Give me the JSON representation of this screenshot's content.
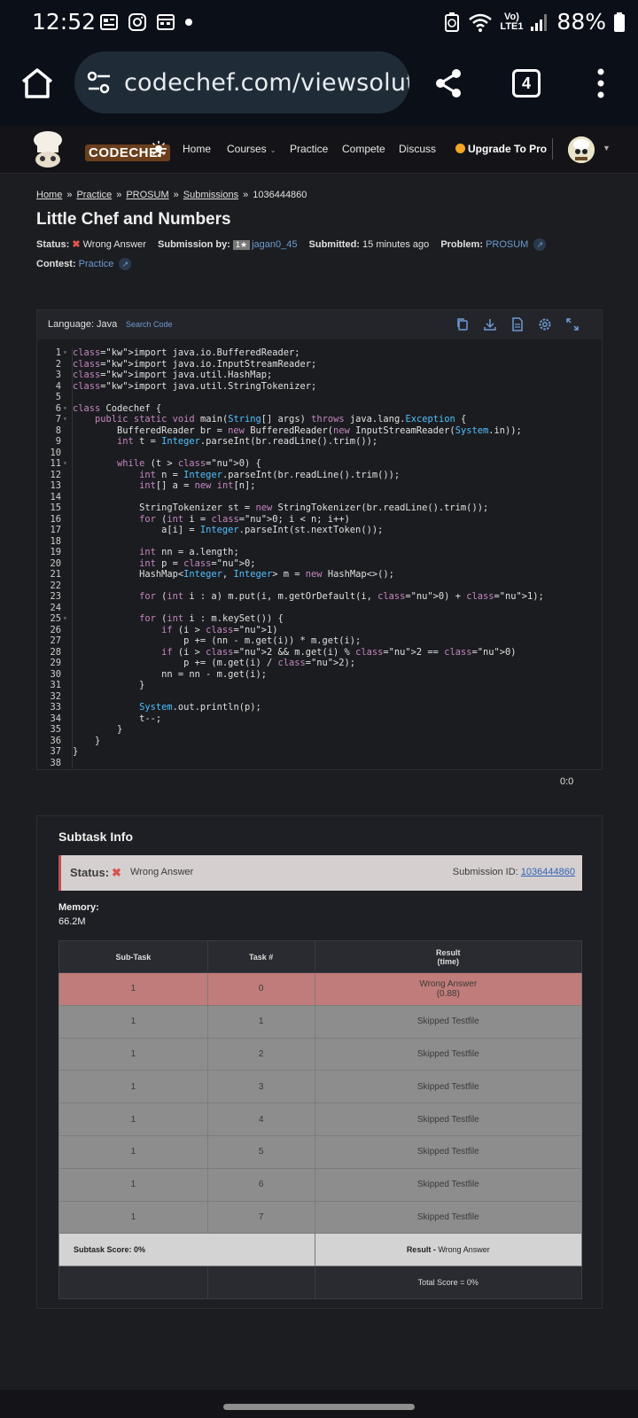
{
  "statusbar": {
    "time": "12:52",
    "network": "Vo) LTE1",
    "battery": "88%"
  },
  "browser": {
    "url": "codechef.com/viewsolut",
    "tab_count": "4"
  },
  "nav": {
    "logo": "CODECHEF",
    "items": [
      "Home",
      "Courses",
      "Practice",
      "Compete",
      "Discuss"
    ],
    "upgrade": "Upgrade To Pro"
  },
  "breadcrumb": [
    "Home",
    "Practice",
    "PROSUM",
    "Submissions",
    "1036444860"
  ],
  "title": "Little Chef and Numbers",
  "meta": {
    "status_label": "Status:",
    "status_value": "Wrong Answer",
    "by_label": "Submission by:",
    "rating_badge": "1★",
    "user": "jagan0_45",
    "submitted_label": "Submitted:",
    "submitted_value": "15 minutes ago",
    "problem_label": "Problem:",
    "problem_value": "PROSUM",
    "contest_label": "Contest:",
    "contest_value": "Practice"
  },
  "editor": {
    "language": "Language: Java",
    "search": "Search Code",
    "cursor": "0:0",
    "lines": [
      "import java.io.BufferedReader;",
      "import java.io.InputStreamReader;",
      "import java.util.HashMap;",
      "import java.util.StringTokenizer;",
      "",
      "class Codechef {",
      "    public static void main(String[] args) throws java.lang.Exception {",
      "        BufferedReader br = new BufferedReader(new InputStreamReader(System.in));",
      "        int t = Integer.parseInt(br.readLine().trim());",
      "",
      "        while (t > 0) {",
      "            int n = Integer.parseInt(br.readLine().trim());",
      "            int[] a = new int[n];",
      "",
      "            StringTokenizer st = new StringTokenizer(br.readLine().trim());",
      "            for (int i = 0; i < n; i++)",
      "                a[i] = Integer.parseInt(st.nextToken());",
      "",
      "            int nn = a.length;",
      "            int p = 0;",
      "            HashMap<Integer, Integer> m = new HashMap<>();",
      "",
      "            for (int i : a) m.put(i, m.getOrDefault(i, 0) + 1);",
      "",
      "            for (int i : m.keySet()) {",
      "                if (i > 1)",
      "                    p += (nn - m.get(i)) * m.get(i);",
      "                if (i > 2 && m.get(i) % 2 == 0)",
      "                    p += (m.get(i) / 2);",
      "                nn = nn - m.get(i);",
      "            }",
      "",
      "            System.out.println(p);",
      "            t--;",
      "        }",
      "    }",
      "}",
      ""
    ],
    "folds": [
      1,
      6,
      7,
      11,
      25
    ]
  },
  "subtask": {
    "title": "Subtask Info",
    "status_label": "Status:",
    "status_value": "Wrong Answer",
    "submission_id_label": "Submission ID:",
    "submission_id": "1036444860",
    "memory_label": "Memory:",
    "memory_value": "66.2M",
    "headers": [
      "Sub-Task",
      "Task #",
      "Result",
      "(time)"
    ],
    "rows": [
      {
        "subtask": "1",
        "task": "0",
        "result": "Wrong Answer",
        "time": "(0.88)",
        "fail": true
      },
      {
        "subtask": "1",
        "task": "1",
        "result": "Skipped Testfile"
      },
      {
        "subtask": "1",
        "task": "2",
        "result": "Skipped Testfile"
      },
      {
        "subtask": "1",
        "task": "3",
        "result": "Skipped Testfile"
      },
      {
        "subtask": "1",
        "task": "4",
        "result": "Skipped Testfile"
      },
      {
        "subtask": "1",
        "task": "5",
        "result": "Skipped Testfile"
      },
      {
        "subtask": "1",
        "task": "6",
        "result": "Skipped Testfile"
      },
      {
        "subtask": "1",
        "task": "7",
        "result": "Skipped Testfile"
      }
    ],
    "subtask_score": "Subtask Score: 0%",
    "result_label": "Result -",
    "result_value": "Wrong Answer",
    "total_score": "Total Score = 0%"
  },
  "colors": {
    "accent_link": "#6c9bd2",
    "fail_row": "#c07c7a",
    "skipped_row": "#8d8d8d",
    "error": "#e0564f"
  }
}
